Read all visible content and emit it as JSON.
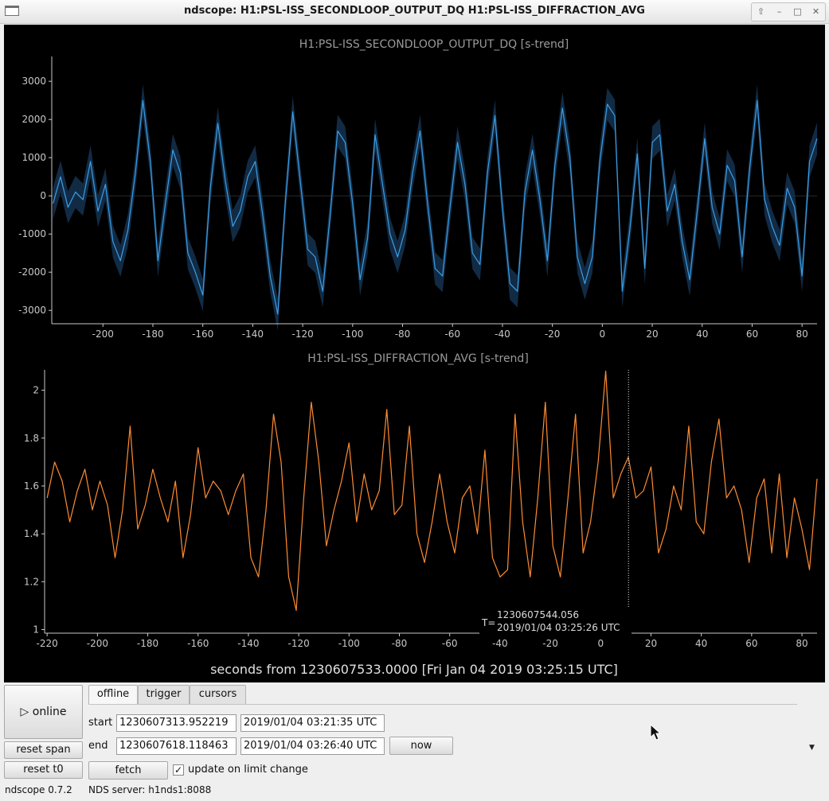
{
  "window": {
    "title": "ndscope: H1:PSL-ISS_SECONDLOOP_OUTPUT_DQ H1:PSL-ISS_DIFFRACTION_AVG"
  },
  "x_axis_label": "seconds from 1230607533.0000 [Fri Jan 04 2019 03:25:15 UTC]",
  "cursor": {
    "t_label": "T=",
    "gps": "1230607544.056",
    "utc": "2019/01/04 03:25:26 UTC",
    "x": 11.06
  },
  "controls": {
    "online_label": "▷ online",
    "reset_span_label": "reset span",
    "reset_t0_label": "reset t0",
    "fetch_label": "fetch",
    "now_label": "now",
    "update_label": "update on limit change",
    "update_checked": true,
    "start_label": "start",
    "end_label": "end",
    "start_gps": "1230607313.952219",
    "start_utc": "2019/01/04 03:21:35 UTC",
    "end_gps": "1230607618.118463",
    "end_utc": "2019/01/04 03:26:40 UTC",
    "tabs": [
      "offline",
      "trigger",
      "cursors"
    ],
    "active_tab": "offline"
  },
  "status": {
    "version": "ndscope 0.7.2",
    "server": "NDS server: h1nds1:8088"
  },
  "colors": {
    "plot_bg": "#000000",
    "series1": "#3a9fe6",
    "series1_band": "#14304d",
    "series2": "#ff8c32",
    "axis": "#c8c8c8",
    "title": "#9a9a9a"
  },
  "chart_data": [
    {
      "type": "line",
      "title": "H1:PSL-ISS_SECONDLOOP_OUTPUT_DQ [s-trend]",
      "xlim": [
        -220.5,
        86
      ],
      "ylim": [
        -3350,
        3650
      ],
      "xticks": [
        -200,
        -180,
        -160,
        -140,
        -120,
        -100,
        -80,
        -60,
        -40,
        -20,
        0,
        20,
        40,
        60,
        80
      ],
      "yticks": [
        3000,
        2000,
        1000,
        0,
        -1000,
        -2000,
        -3000
      ],
      "grid": false,
      "series": [
        {
          "x": [
            -220,
            -217,
            -214,
            -211,
            -208,
            -205,
            -202,
            -199,
            -196,
            -193,
            -190,
            -187,
            -184,
            -181,
            -178,
            -175,
            -172,
            -169,
            -166,
            -163,
            -160,
            -157,
            -154,
            -151,
            -148,
            -145,
            -142,
            -139,
            -136,
            -133,
            -130,
            -127,
            -124,
            -121,
            -118,
            -115,
            -112,
            -109,
            -106,
            -103,
            -100,
            -97,
            -94,
            -91,
            -88,
            -85,
            -82,
            -79,
            -76,
            -73,
            -70,
            -67,
            -64,
            -61,
            -58,
            -55,
            -52,
            -49,
            -46,
            -43,
            -40,
            -37,
            -34,
            -31,
            -28,
            -25,
            -22,
            -19,
            -16,
            -13,
            -10,
            -7,
            -4,
            -1,
            2,
            5,
            8,
            11,
            14,
            17,
            20,
            23,
            26,
            29,
            32,
            35,
            38,
            41,
            44,
            47,
            50,
            53,
            56,
            59,
            62,
            65,
            68,
            71,
            74,
            77,
            80,
            83,
            86
          ],
          "values": [
            -200,
            500,
            -300,
            100,
            -100,
            900,
            -400,
            300,
            -1200,
            -1700,
            -900,
            600,
            2500,
            900,
            -1700,
            -200,
            1200,
            600,
            -1500,
            -2000,
            -2600,
            200,
            1900,
            400,
            -800,
            -400,
            500,
            900,
            -500,
            -2100,
            -3100,
            -200,
            2200,
            400,
            -1400,
            -1600,
            -2500,
            -500,
            1700,
            1400,
            -200,
            -2200,
            -1100,
            1600,
            300,
            -1000,
            -1600,
            -900,
            600,
            1700,
            -200,
            -1900,
            -2100,
            -300,
            1400,
            300,
            -1500,
            -1800,
            600,
            2100,
            -300,
            -2300,
            -2500,
            100,
            1200,
            -100,
            -1700,
            800,
            2300,
            1000,
            -1600,
            -2300,
            -1600,
            900,
            2400,
            2100,
            -2500,
            -900,
            1100,
            -1900,
            1400,
            1600,
            -400,
            300,
            -1200,
            -2200,
            -400,
            1500,
            -300,
            -1000,
            800,
            400,
            -1600,
            700,
            2500,
            -100,
            -800,
            -1300,
            200,
            -300,
            -2100,
            900,
            1500
          ]
        }
      ]
    },
    {
      "type": "line",
      "title": "H1:PSL-ISS_DIFFRACTION_AVG [s-trend]",
      "xlim": [
        -221,
        86
      ],
      "ylim": [
        0.985,
        2.085
      ],
      "xticks": [
        -220,
        -200,
        -180,
        -160,
        -140,
        -120,
        -100,
        -80,
        -60,
        -40,
        -20,
        0,
        20,
        40,
        60,
        80
      ],
      "yticks": [
        2,
        1.8,
        1.6,
        1.4,
        1.2,
        1
      ],
      "grid": false,
      "series": [
        {
          "x": [
            -220,
            -217,
            -214,
            -211,
            -208,
            -205,
            -202,
            -199,
            -196,
            -193,
            -190,
            -187,
            -184,
            -181,
            -178,
            -175,
            -172,
            -169,
            -166,
            -163,
            -160,
            -157,
            -154,
            -151,
            -148,
            -145,
            -142,
            -139,
            -136,
            -133,
            -130,
            -127,
            -124,
            -121,
            -118,
            -115,
            -112,
            -109,
            -106,
            -103,
            -100,
            -97,
            -94,
            -91,
            -88,
            -85,
            -82,
            -79,
            -76,
            -73,
            -70,
            -67,
            -64,
            -61,
            -58,
            -55,
            -52,
            -49,
            -46,
            -43,
            -40,
            -37,
            -34,
            -31,
            -28,
            -25,
            -22,
            -19,
            -16,
            -13,
            -10,
            -7,
            -4,
            -1,
            2,
            5,
            8,
            11,
            14,
            17,
            20,
            23,
            26,
            29,
            32,
            35,
            38,
            41,
            44,
            47,
            50,
            53,
            56,
            59,
            62,
            65,
            68,
            71,
            74,
            77,
            80,
            83,
            86
          ],
          "values": [
            1.55,
            1.7,
            1.62,
            1.45,
            1.58,
            1.67,
            1.5,
            1.62,
            1.52,
            1.3,
            1.5,
            1.85,
            1.42,
            1.52,
            1.67,
            1.55,
            1.45,
            1.62,
            1.3,
            1.48,
            1.76,
            1.55,
            1.62,
            1.58,
            1.48,
            1.58,
            1.65,
            1.3,
            1.22,
            1.5,
            1.9,
            1.7,
            1.22,
            1.08,
            1.55,
            1.95,
            1.7,
            1.35,
            1.5,
            1.62,
            1.78,
            1.45,
            1.65,
            1.5,
            1.58,
            1.92,
            1.48,
            1.52,
            1.85,
            1.4,
            1.28,
            1.45,
            1.65,
            1.45,
            1.32,
            1.55,
            1.6,
            1.4,
            1.75,
            1.3,
            1.22,
            1.25,
            1.9,
            1.45,
            1.22,
            1.55,
            1.95,
            1.35,
            1.22,
            1.55,
            1.9,
            1.32,
            1.45,
            1.7,
            2.08,
            1.55,
            1.65,
            1.72,
            1.55,
            1.58,
            1.68,
            1.32,
            1.42,
            1.6,
            1.5,
            1.85,
            1.45,
            1.4,
            1.7,
            1.88,
            1.55,
            1.6,
            1.5,
            1.28,
            1.55,
            1.63,
            1.32,
            1.65,
            1.3,
            1.55,
            1.42,
            1.25,
            1.63
          ]
        }
      ]
    }
  ]
}
